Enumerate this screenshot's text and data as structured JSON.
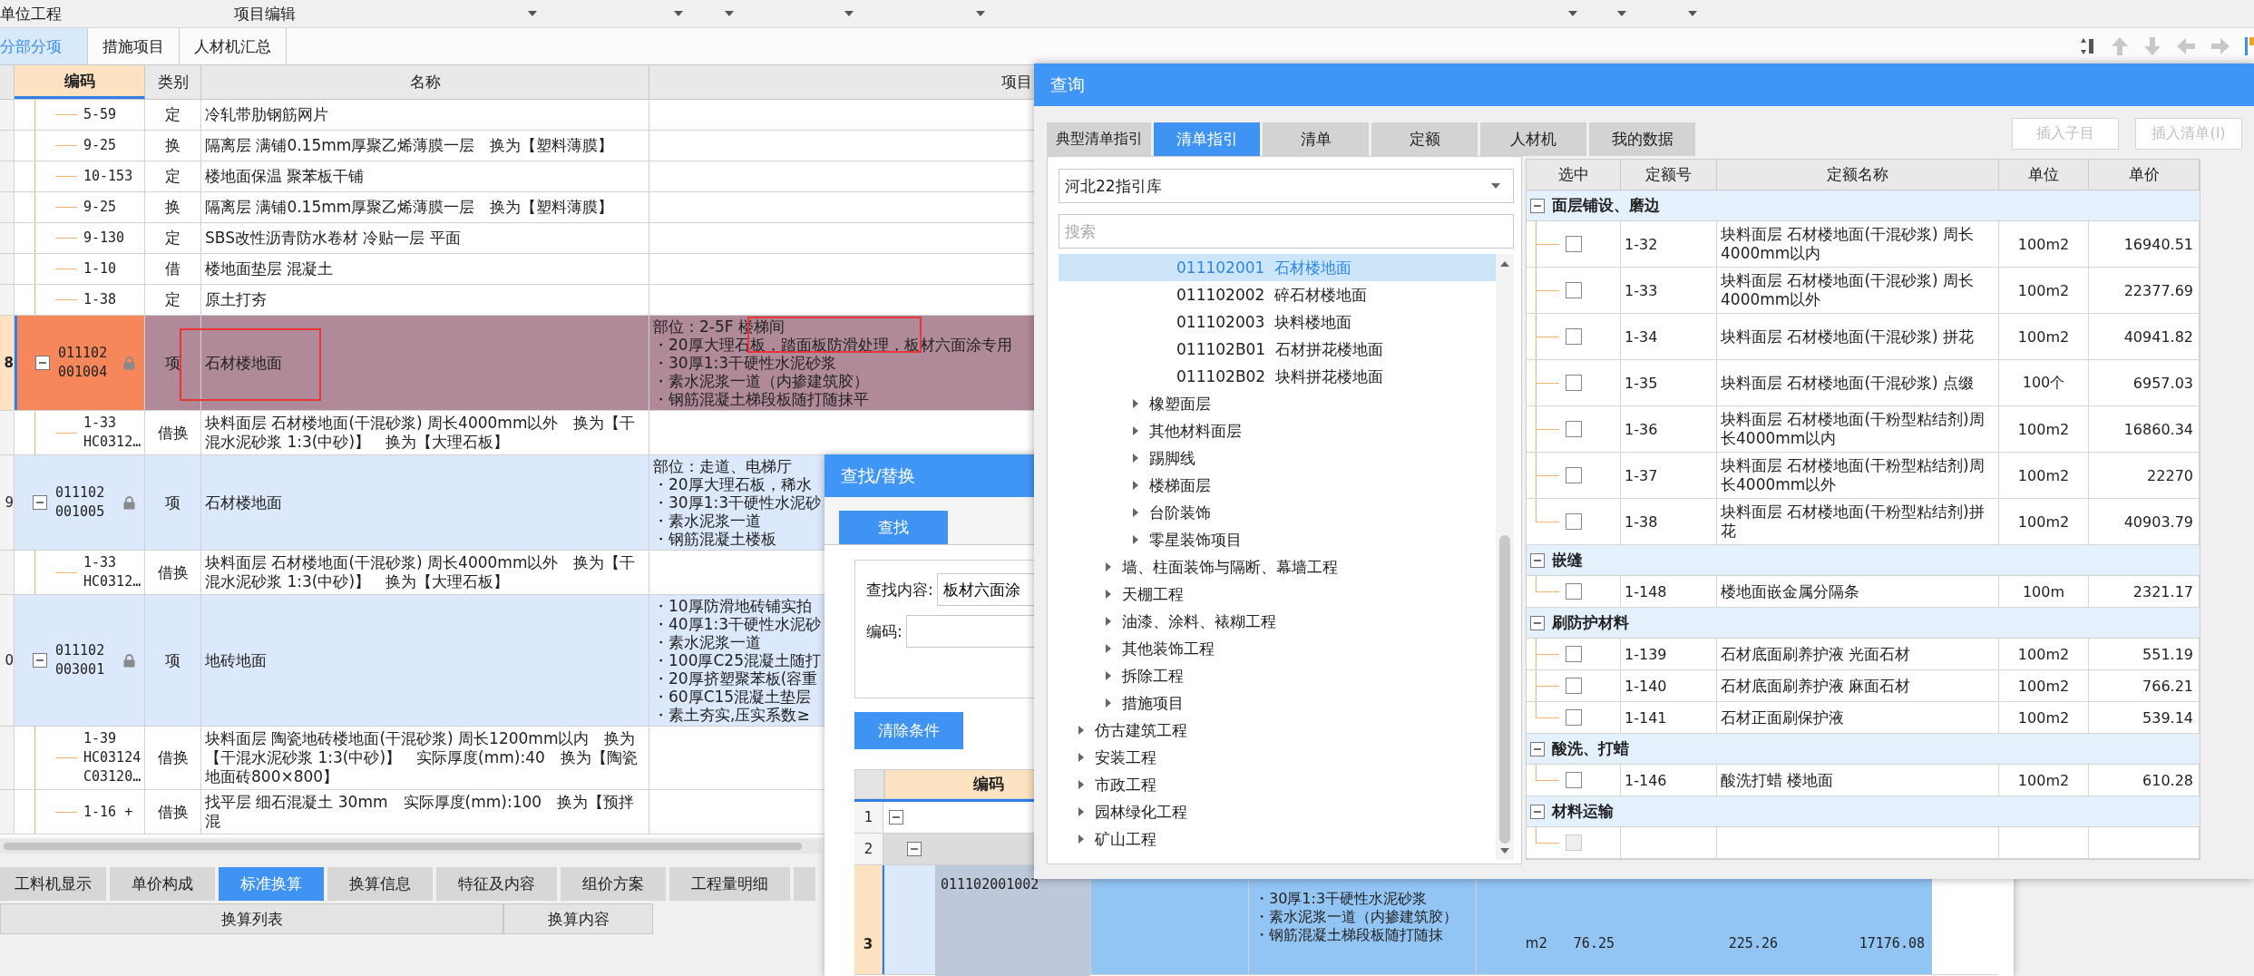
{
  "main": {
    "menu_bar": [
      "单位工程",
      "项目编辑"
    ],
    "tabs": [
      {
        "label": "分部分项",
        "selected": true
      },
      {
        "label": "措施项目",
        "selected": false
      },
      {
        "label": "人材机汇总",
        "selected": false
      }
    ],
    "grid": {
      "columns": [
        "编码",
        "类别",
        "名称",
        "项目"
      ],
      "rows": [
        {
          "kind": "sub",
          "selected": false,
          "code": [
            "5-59"
          ],
          "type": "定",
          "name": "冷轧带肋钢筋网片"
        },
        {
          "kind": "sub",
          "selected": false,
          "code": [
            "9-25"
          ],
          "type": "换",
          "name": "隔离层 满铺0.15mm厚聚乙烯薄膜一层　换为【塑料薄膜】"
        },
        {
          "kind": "sub",
          "selected": false,
          "code": [
            "10-153"
          ],
          "type": "定",
          "name": "楼地面保温 聚苯板干铺"
        },
        {
          "kind": "sub",
          "selected": false,
          "code": [
            "9-25"
          ],
          "type": "换",
          "name": "隔离层 满铺0.15mm厚聚乙烯薄膜一层　换为【塑料薄膜】"
        },
        {
          "kind": "sub",
          "selected": false,
          "code": [
            "9-130"
          ],
          "type": "定",
          "name": "SBS改性沥青防水卷材 冷贴一层 平面"
        },
        {
          "kind": "sub",
          "selected": false,
          "code": [
            "1-10"
          ],
          "type": "借",
          "name": "楼地面垫层 混凝土"
        },
        {
          "kind": "sub",
          "selected": false,
          "code": [
            "1-38"
          ],
          "type": "定",
          "name": "原土打夯"
        },
        {
          "kind": "item",
          "selected": true,
          "number": "8",
          "code": [
            "011102",
            "001004"
          ],
          "locked": true,
          "type": "项",
          "name": "石材楼地面",
          "name_marked": true,
          "features_marked": true,
          "features": [
            "部位：2-5F 楼梯间",
            "・20厚大理石板，踏面板防滑处理，板材六面涂专用",
            "・30厚1:3干硬性水泥砂浆",
            "・素水泥浆一道（内掺建筑胶）",
            "・钢筋混凝土梯段板随打随抹平"
          ]
        },
        {
          "kind": "sub",
          "selected": false,
          "code": [
            "1-33",
            "HC0312…"
          ],
          "type": "借换",
          "name": "块料面层 石材楼地面(干混砂浆) 周长4000mm以外　换为【干混水泥砂浆 1:3(中砂)】　换为【大理石板】"
        },
        {
          "kind": "item",
          "selected": false,
          "number": "9",
          "code": [
            "011102",
            "001005"
          ],
          "locked": true,
          "type": "项",
          "name": "石材楼地面",
          "name_marked": false,
          "features_marked": false,
          "features": [
            "部位：走道、电梯厅",
            "・20厚大理石板，稀水",
            "・30厚1:3干硬性水泥砂",
            "・素水泥浆一道",
            "・钢筋混凝土楼板"
          ]
        },
        {
          "kind": "sub",
          "selected": false,
          "code": [
            "1-33",
            "HC0312…"
          ],
          "type": "借换",
          "name": "块料面层 石材楼地面(干混砂浆) 周长4000mm以外　换为【干混水泥砂浆 1:3(中砂)】　换为【大理石板】"
        },
        {
          "kind": "item",
          "selected": false,
          "number": "0",
          "code": [
            "011102",
            "003001"
          ],
          "locked": true,
          "type": "项",
          "name": "地砖地面",
          "name_marked": false,
          "features_marked": false,
          "features": [
            "・10厚防滑地砖铺实拍",
            "・40厚1:3干硬性水泥砂",
            "・素水泥浆一道",
            "・100厚C25混凝土随打",
            "・20厚挤塑聚苯板(容重",
            "・60厚C15混凝土垫层",
            "・素土夯实,压实系数≥"
          ]
        },
        {
          "kind": "sub",
          "selected": false,
          "code": [
            "1-39",
            "HC03124",
            "C03120…"
          ],
          "type": "借换",
          "name": "块料面层 陶瓷地砖楼地面(干混砂浆) 周长1200mm以内　换为【干混水泥砂浆 1:3(中砂)】　实际厚度(mm):40　换为【陶瓷地面砖800×800】"
        },
        {
          "kind": "sub",
          "selected": false,
          "code": [
            "1-16 +"
          ],
          "type": "借换",
          "name": "找平层 细石混凝土 30mm　实际厚度(mm):100　换为【预拌混"
        }
      ]
    },
    "bottom_tabs": [
      {
        "label": "工料机显示",
        "selected": false
      },
      {
        "label": "单价构成",
        "selected": false
      },
      {
        "label": "标准换算",
        "selected": true
      },
      {
        "label": "换算信息",
        "selected": false
      },
      {
        "label": "特征及内容",
        "selected": false
      },
      {
        "label": "组价方案",
        "selected": false
      },
      {
        "label": "工程量明细",
        "selected": false
      }
    ],
    "conversion_columns": [
      "换算列表",
      "换算内容"
    ]
  },
  "find_dialog": {
    "title": "查找/替换",
    "tabs": [
      {
        "label": "查找",
        "selected": true
      }
    ],
    "fields": [
      {
        "label": "查找内容:",
        "value": "板材六面涂"
      },
      {
        "label": "编码:"
      }
    ],
    "button": "清除条件",
    "table": {
      "columns": [
        "编码"
      ],
      "rows": [
        {
          "number": "1",
          "selected": false,
          "expanded": true
        },
        {
          "number": "2",
          "selected": false,
          "expanded": true
        },
        {
          "number": "3",
          "selected": true,
          "code": "011102001002",
          "features": [
            "・30厚1:3干硬性水泥砂浆",
            "・素水泥浆一道（内掺建筑胶）",
            "・钢筋混凝土梯段板随打随抹"
          ],
          "unit": "m2",
          "values": [
            "76.25",
            "225.26",
            "17176.08"
          ]
        }
      ]
    }
  },
  "query_dialog": {
    "title": "查询",
    "tabs": [
      {
        "label": "典型清单指引",
        "selected": false
      },
      {
        "label": "清单指引",
        "selected": true
      },
      {
        "label": "清单",
        "selected": false
      },
      {
        "label": "定额",
        "selected": false
      },
      {
        "label": "人材机",
        "selected": false
      },
      {
        "label": "我的数据",
        "selected": false
      }
    ],
    "buttons": [
      {
        "label": "插入子目",
        "disabled": true
      },
      {
        "label": "插入清单(I)",
        "disabled": true
      }
    ],
    "library": "河北22指引库",
    "search_placeholder": "搜索",
    "tree": [
      {
        "children": [
          {
            "children": [
              {
                "children": [
                  {
                    "code": "011102001",
                    "label": "石材楼地面",
                    "selected": true
                  },
                  {
                    "code": "011102002",
                    "label": "碎石材楼地面",
                    "selected": false
                  },
                  {
                    "code": "011102003",
                    "label": "块料楼地面",
                    "selected": false
                  },
                  {
                    "code": "011102B01",
                    "label": "石材拼花楼地面",
                    "selected": false
                  },
                  {
                    "code": "011102B02",
                    "label": "块料拼花楼地面",
                    "selected": false
                  }
                ]
              },
              {
                "label": "橡塑面层",
                "expanded": false
              },
              {
                "label": "其他材料面层",
                "expanded": false
              },
              {
                "label": "踢脚线",
                "expanded": false
              },
              {
                "label": "楼梯面层",
                "expanded": false
              },
              {
                "label": "台阶装饰",
                "expanded": false
              },
              {
                "label": "零星装饰项目",
                "expanded": false
              }
            ]
          },
          {
            "label": "墙、柱面装饰与隔断、幕墙工程",
            "expanded": false
          },
          {
            "label": "天棚工程",
            "expanded": false
          },
          {
            "label": "油漆、涂料、裱糊工程",
            "expanded": false
          },
          {
            "label": "其他装饰工程",
            "expanded": false
          },
          {
            "label": "拆除工程",
            "expanded": false
          },
          {
            "label": "措施项目",
            "expanded": false
          }
        ]
      },
      {
        "label": "仿古建筑工程",
        "expanded": false
      },
      {
        "label": "安装工程",
        "expanded": false
      },
      {
        "label": "市政工程",
        "expanded": false
      },
      {
        "label": "园林绿化工程",
        "expanded": false
      },
      {
        "label": "矿山工程",
        "expanded": false
      }
    ],
    "table": {
      "columns": [
        "选中",
        "定额号",
        "定额名称",
        "单位",
        "单价"
      ],
      "groups": [
        {
          "name": "面层铺设、磨边",
          "expanded": true,
          "rows": [
            {
              "checked": false,
              "code": "1-32",
              "name": "块料面层 石材楼地面(干混砂浆) 周长4000mm以内",
              "unit": "100m2",
              "price": "16940.51"
            },
            {
              "checked": false,
              "code": "1-33",
              "name": "块料面层 石材楼地面(干混砂浆) 周长4000mm以外",
              "unit": "100m2",
              "price": "22377.69"
            },
            {
              "checked": false,
              "code": "1-34",
              "name": "块料面层 石材楼地面(干混砂浆) 拼花",
              "unit": "100m2",
              "price": "40941.82"
            },
            {
              "checked": false,
              "code": "1-35",
              "name": "块料面层 石材楼地面(干混砂浆) 点缀",
              "unit": "100个",
              "price": "6957.03"
            },
            {
              "checked": false,
              "code": "1-36",
              "name": "块料面层 石材楼地面(干粉型粘结剂)周长4000mm以内",
              "unit": "100m2",
              "price": "16860.34"
            },
            {
              "checked": false,
              "code": "1-37",
              "name": "块料面层 石材楼地面(干粉型粘结剂)周长4000mm以外",
              "unit": "100m2",
              "price": "22270"
            },
            {
              "checked": false,
              "code": "1-38",
              "name": "块料面层 石材楼地面(干粉型粘结剂)拼花",
              "unit": "100m2",
              "price": "40903.79"
            }
          ]
        },
        {
          "name": "嵌缝",
          "expanded": true,
          "rows": [
            {
              "checked": false,
              "code": "1-148",
              "name": "楼地面嵌金属分隔条",
              "unit": "100m",
              "price": "2321.17"
            }
          ]
        },
        {
          "name": "刷防护材料",
          "expanded": true,
          "rows": [
            {
              "checked": false,
              "code": "1-139",
              "name": "石材底面刷养护液 光面石材",
              "unit": "100m2",
              "price": "551.19"
            },
            {
              "checked": false,
              "code": "1-140",
              "name": "石材底面刷养护液 麻面石材",
              "unit": "100m2",
              "price": "766.21"
            },
            {
              "checked": false,
              "code": "1-141",
              "name": "石材正面刷保护液",
              "unit": "100m2",
              "price": "539.14"
            }
          ]
        },
        {
          "name": "酸洗、打蜡",
          "expanded": true,
          "rows": [
            {
              "checked": false,
              "code": "1-146",
              "name": "酸洗打蜡 楼地面",
              "unit": "100m2",
              "price": "610.28"
            }
          ]
        },
        {
          "name": "材料运输",
          "expanded": true,
          "rows": [
            {
              "checked": false,
              "disabled": true
            }
          ]
        }
      ]
    }
  }
}
